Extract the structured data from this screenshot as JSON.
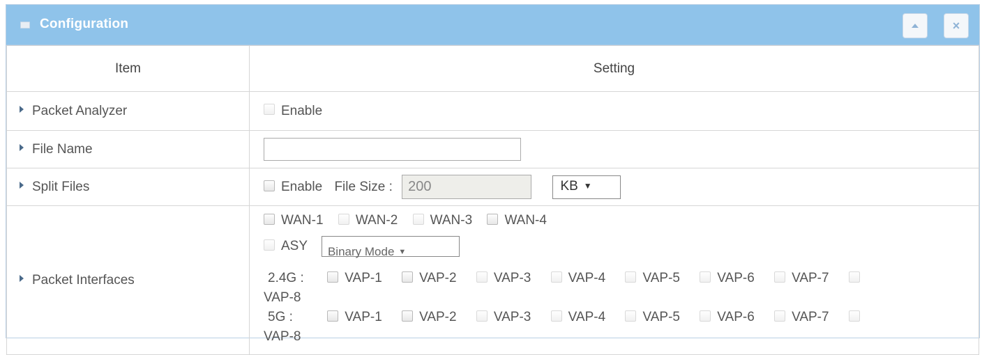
{
  "panel": {
    "title": "Configuration",
    "collapse_icon": "chevron-up-icon",
    "close_icon": "close-icon",
    "header_color": "#8fc3ea"
  },
  "table": {
    "headers": {
      "item": "Item",
      "setting": "Setting"
    },
    "rows": {
      "packet_analyzer": {
        "label": "Packet Analyzer",
        "enable_label": "Enable"
      },
      "file_name": {
        "label": "File Name",
        "value": ""
      },
      "split_files": {
        "label": "Split Files",
        "enable_label": "Enable",
        "file_size_label": "File Size :",
        "file_size_value": "200",
        "unit": "KB"
      },
      "packet_interfaces": {
        "label": "Packet Interfaces",
        "wan": [
          "WAN-1",
          "WAN-2",
          "WAN-3",
          "WAN-4"
        ],
        "asy_label": "ASY",
        "mode_value": "Binary Mode",
        "band_24_label": "2.4G :",
        "band_5_label": "5G :",
        "vaps": [
          "VAP-1",
          "VAP-2",
          "VAP-3",
          "VAP-4",
          "VAP-5",
          "VAP-6",
          "VAP-7",
          "VAP-8"
        ]
      }
    }
  }
}
